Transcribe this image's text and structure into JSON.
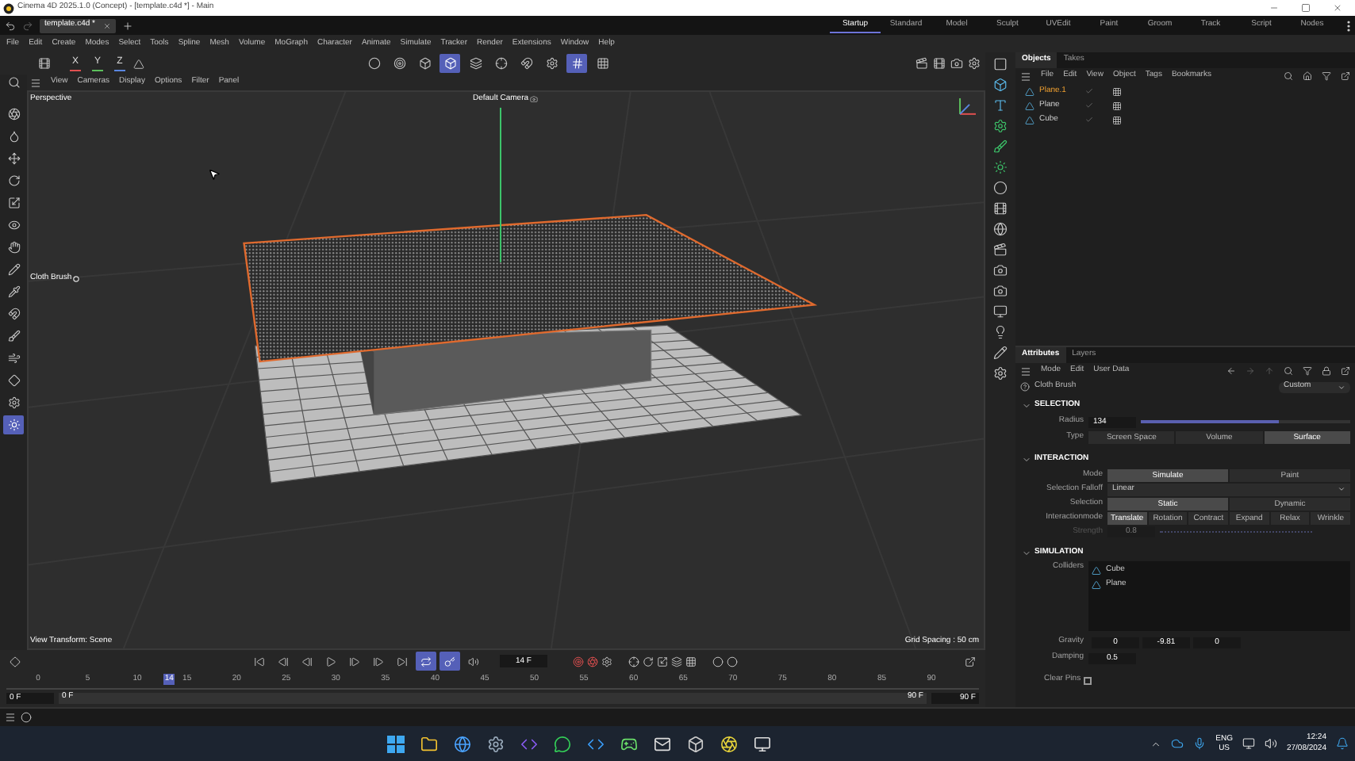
{
  "window": {
    "title": "Cinema 4D 2025.1.0 (Concept) - [template.c4d *] - Main"
  },
  "document_tabs": [
    {
      "label": "template.c4d *",
      "selected": true
    }
  ],
  "layouts": [
    {
      "label": "Startup",
      "selected": true
    },
    {
      "label": "Standard",
      "selected": false
    },
    {
      "label": "Model",
      "selected": false
    },
    {
      "label": "Sculpt",
      "selected": false
    },
    {
      "label": "UVEdit",
      "selected": false
    },
    {
      "label": "Paint",
      "selected": false
    },
    {
      "label": "Groom",
      "selected": false
    },
    {
      "label": "Track",
      "selected": false
    },
    {
      "label": "Script",
      "selected": false
    },
    {
      "label": "Nodes",
      "selected": false
    }
  ],
  "menu": [
    "File",
    "Edit",
    "Create",
    "Modes",
    "Select",
    "Tools",
    "Spline",
    "Mesh",
    "Volume",
    "MoGraph",
    "Character",
    "Animate",
    "Simulate",
    "Tracker",
    "Render",
    "Extensions",
    "Window",
    "Help"
  ],
  "axis_lock": [
    {
      "label": "X",
      "color": "#e05050"
    },
    {
      "label": "Y",
      "color": "#5cc05c"
    },
    {
      "label": "Z",
      "color": "#5a86e0"
    }
  ],
  "mode_tools": [
    {
      "active": false
    },
    {
      "active": false
    },
    {
      "active": false
    },
    {
      "active": true
    },
    {
      "active": false
    },
    {
      "active": false
    },
    {
      "active": false
    },
    {
      "active": false
    },
    {
      "active": true
    },
    {
      "active": false
    }
  ],
  "left_tools": [
    {
      "active": false
    },
    {
      "active": false
    },
    {
      "active": false
    },
    {
      "active": false
    },
    {
      "active": false
    },
    {
      "active": false
    },
    {
      "active": false
    },
    {
      "active": false
    },
    {
      "active": false
    },
    {
      "active": false
    },
    {
      "active": false
    },
    {
      "active": false
    },
    {
      "active": false
    },
    {
      "active": false
    },
    {
      "active": true
    }
  ],
  "viewport": {
    "menu": [
      "View",
      "Cameras",
      "Display",
      "Options",
      "Filter",
      "Panel"
    ],
    "name": "Perspective",
    "camera": "Default Camera",
    "tool_label": "Cloth Brush",
    "view_transform": "View Transform: Scene",
    "grid_spacing": "Grid Spacing : 50 cm"
  },
  "timeline": {
    "transport": [
      {
        "active": false
      },
      {
        "active": false
      },
      {
        "active": false
      },
      {
        "active": false
      },
      {
        "active": false
      },
      {
        "active": false
      },
      {
        "active": false
      },
      {
        "active": true
      },
      {
        "active": true
      },
      {
        "active": false
      }
    ],
    "current_frame": "14 F",
    "ticks": [
      "0",
      "5",
      "10",
      "15",
      "20",
      "25",
      "30",
      "35",
      "40",
      "45",
      "50",
      "55",
      "60",
      "65",
      "70",
      "75",
      "80",
      "85",
      "90"
    ],
    "playhead": {
      "label": "14",
      "level": 0.156
    },
    "start": "0 F",
    "range_start": "0 F",
    "range_end": "90 F",
    "end": "90 F"
  },
  "objects_panel": {
    "tabs": [
      {
        "label": "Objects",
        "selected": true
      },
      {
        "label": "Takes",
        "selected": false
      }
    ],
    "menu": [
      "File",
      "Edit",
      "View",
      "Object",
      "Tags",
      "Bookmarks"
    ],
    "objects": [
      {
        "name": "Plane.1",
        "selected": true
      },
      {
        "name": "Plane",
        "selected": false
      },
      {
        "name": "Cube",
        "selected": false
      }
    ]
  },
  "attributes": {
    "tabs": [
      {
        "label": "Attributes",
        "selected": true
      },
      {
        "label": "Layers",
        "selected": false
      }
    ],
    "menu": [
      "Mode",
      "Edit",
      "User Data"
    ],
    "object": "Cloth Brush",
    "preset": "Custom",
    "selection": {
      "title": "SELECTION",
      "radius": {
        "label": "Radius",
        "value": "134",
        "level": 0.66
      },
      "type": {
        "label": "Type",
        "options": [
          {
            "label": "Screen Space",
            "selected": false
          },
          {
            "label": "Volume",
            "selected": false
          },
          {
            "label": "Surface",
            "selected": true
          }
        ]
      }
    },
    "interaction": {
      "title": "INTERACTION",
      "mode": {
        "label": "Mode",
        "options": [
          {
            "label": "Simulate",
            "selected": true
          },
          {
            "label": "Paint",
            "selected": false
          }
        ]
      },
      "falloff": {
        "label": "Selection Falloff",
        "value": "Linear"
      },
      "selection": {
        "label": "Selection",
        "options": [
          {
            "label": "Static",
            "selected": true
          },
          {
            "label": "Dynamic",
            "selected": false
          }
        ]
      },
      "interactionmode": {
        "label": "Interactionmode",
        "options": [
          {
            "label": "Translate",
            "selected": true
          },
          {
            "label": "Rotation",
            "selected": false
          },
          {
            "label": "Contract",
            "selected": false
          },
          {
            "label": "Expand",
            "selected": false
          },
          {
            "label": "Relax",
            "selected": false
          },
          {
            "label": "Wrinkle",
            "selected": false
          }
        ]
      },
      "strength": {
        "label": "Strength",
        "value": "0.8",
        "level": 0.8,
        "disabled": true
      }
    },
    "simulation": {
      "title": "SIMULATION",
      "colliders": {
        "label": "Colliders",
        "items": [
          "Cube",
          "Plane"
        ]
      },
      "gravity": {
        "label": "Gravity",
        "values": [
          "0",
          "-9.81",
          "0"
        ]
      },
      "damping": {
        "label": "Damping",
        "value": "0.5"
      },
      "clear_pins": {
        "label": "Clear Pins",
        "checked": false
      }
    }
  },
  "tray": {
    "language": "ENG",
    "region": "US",
    "time": "12:24",
    "date": "27/08/2024"
  }
}
